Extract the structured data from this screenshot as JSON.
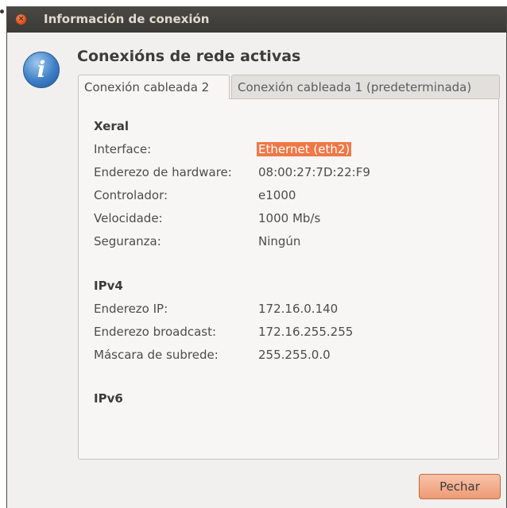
{
  "window": {
    "title": "Información de conexión"
  },
  "icons": {
    "close": "×",
    "info": "i"
  },
  "heading": "Conexións de rede activas",
  "tabs": [
    {
      "label": "Conexión cableada 2",
      "active": true
    },
    {
      "label": "Conexión cableada 1 (predeterminada)",
      "active": false
    }
  ],
  "sections": {
    "general": {
      "title": "Xeral",
      "rows": [
        {
          "label": "Interface:",
          "value": "Ethernet (eth2)"
        },
        {
          "label": "Enderezo de hardware:",
          "value": "08:00:27:7D:22:F9"
        },
        {
          "label": "Controlador:",
          "value": "e1000"
        },
        {
          "label": "Velocidade:",
          "value": "1000 Mb/s"
        },
        {
          "label": "Seguranza:",
          "value": "Ningún"
        }
      ]
    },
    "ipv4": {
      "title": "IPv4",
      "rows": [
        {
          "label": "Enderezo IP:",
          "value": "172.16.0.140"
        },
        {
          "label": "Enderezo broadcast:",
          "value": "172.16.255.255"
        },
        {
          "label": "Máscara de subrede:",
          "value": "255.255.0.0"
        }
      ]
    },
    "ipv6": {
      "title": "IPv6"
    }
  },
  "buttons": {
    "close_label": "Pechar"
  },
  "colors": {
    "accent": "#f07746",
    "titlebar": "#3c3b37"
  }
}
